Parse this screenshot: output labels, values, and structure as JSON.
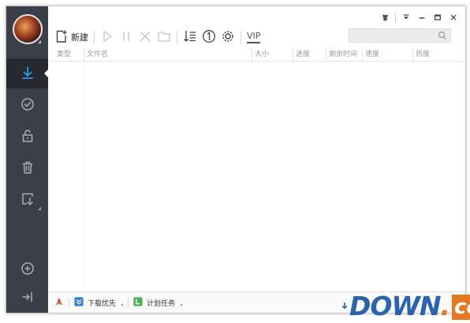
{
  "toolbar": {
    "new_label": "新建",
    "vip_label": "VIP"
  },
  "search": {
    "placeholder": ""
  },
  "columns": [
    "类型",
    "文件名",
    "大小",
    "进度",
    "剩余时间",
    "速度",
    "热度"
  ],
  "statusbar": {
    "priority_label": "下载优先",
    "schedule_label": "计划任务"
  },
  "watermark": {
    "main": "DOWN",
    "dot": ".",
    "tld": "cc"
  },
  "colors": {
    "sidebar": "#3b4048",
    "accent_blue": "#2a64b0",
    "accent_orange": "#e87722",
    "schedule_green": "#4caf50"
  },
  "icons": {
    "sidebar": [
      "download-icon",
      "check-circle-icon",
      "unlock-icon",
      "trash-icon",
      "import-icon",
      "add-circle-icon",
      "exit-icon"
    ]
  }
}
